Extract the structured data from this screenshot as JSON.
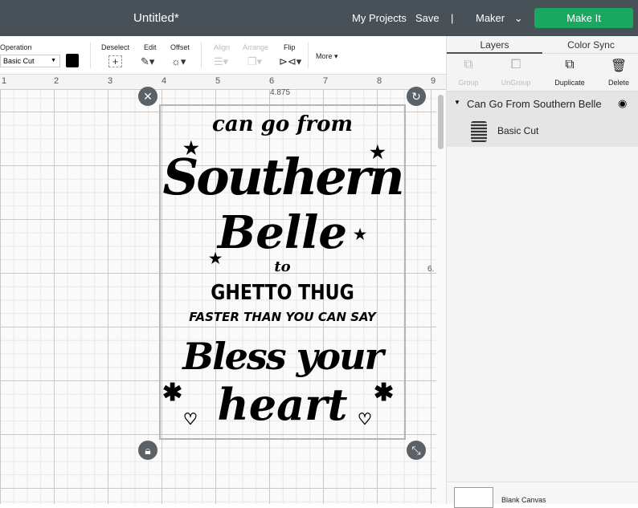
{
  "topbar": {
    "title": "Untitled*",
    "my_projects": "My Projects",
    "save": "Save",
    "divider": "|",
    "machine": "Maker",
    "make_it": "Make It"
  },
  "toolbar": {
    "operation_label": "Operation",
    "operation_value": "Basic Cut",
    "color": "#000000",
    "deselect": "Deselect",
    "edit": "Edit",
    "offset": "Offset",
    "align": "Align",
    "arrange": "Arrange",
    "flip": "Flip",
    "more": "More"
  },
  "ruler": {
    "marks": [
      "1",
      "2",
      "3",
      "4",
      "5",
      "6",
      "7",
      "8",
      "9"
    ]
  },
  "canvas": {
    "width_label": "4.875",
    "height_label": "6.",
    "art_lines": [
      "can go from",
      "Southern",
      "Belle",
      "to",
      "GHETTO THUG",
      "FASTER THAN YOU CAN SAY",
      "Bless your",
      "heart"
    ]
  },
  "panel": {
    "tabs": [
      "Layers",
      "Color Sync"
    ],
    "tools": [
      {
        "label": "Group",
        "enabled": false
      },
      {
        "label": "UnGroup",
        "enabled": false
      },
      {
        "label": "Duplicate",
        "enabled": true
      },
      {
        "label": "Delete",
        "enabled": true
      }
    ],
    "layer_group": "Can Go From Southern Belle",
    "layer_item": "Basic Cut",
    "blank_canvas": "Blank Canvas"
  }
}
